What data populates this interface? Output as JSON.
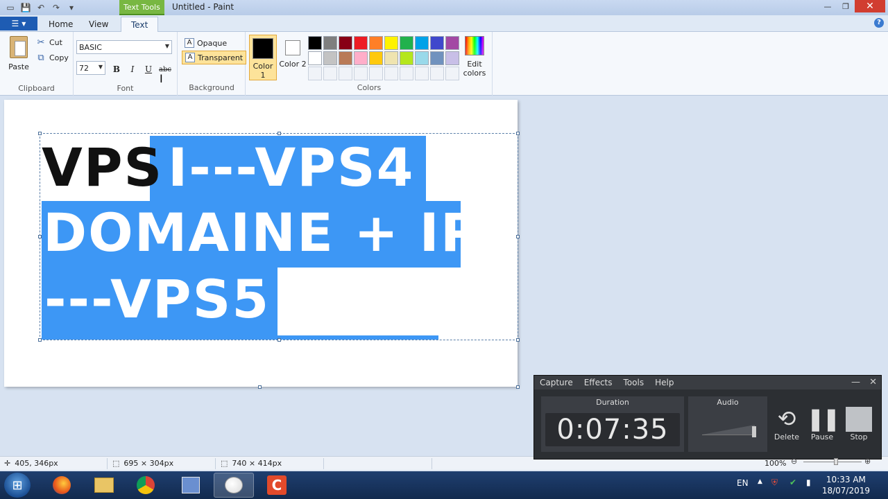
{
  "window": {
    "title": "Untitled - Paint",
    "context_tab": "Text Tools"
  },
  "tabs": [
    {
      "label": "Home"
    },
    {
      "label": "View"
    },
    {
      "label": "Text"
    }
  ],
  "clipboard": {
    "paste": "Paste",
    "cut": "Cut",
    "copy": "Copy",
    "group": "Clipboard"
  },
  "font": {
    "family": "BASIC",
    "size": "72",
    "bold": "B",
    "italic": "I",
    "underline": "U",
    "strike": "abc",
    "group": "Font"
  },
  "background": {
    "opaque": "Opaque",
    "transparent": "Transparent",
    "group": "Background"
  },
  "colors": {
    "color1_label": "Color 1",
    "color2_label": "Color 2",
    "group": "Colors",
    "edit": "Edit colors",
    "color1": "#000000",
    "color2": "#ffffff",
    "palette": [
      "#000000",
      "#7f7f7f",
      "#880015",
      "#ed1c24",
      "#ff7f27",
      "#fff200",
      "#22b14c",
      "#00a2e8",
      "#3f48cc",
      "#a349a4",
      "#ffffff",
      "#c3c3c3",
      "#b97a57",
      "#ffaec9",
      "#ffc90e",
      "#efe4b0",
      "#b5e61d",
      "#99d9ea",
      "#7092be",
      "#c8bfe7"
    ]
  },
  "canvas": {
    "line1_black": "VPS",
    "line1_white": "I---VPS4",
    "line2": "DOMAINE + IP",
    "line3": "---VPS5",
    "highlight_color": "#3d97f5"
  },
  "status": {
    "cursor": "405, 346px",
    "selection": "695 × 304px",
    "image": "740 × 414px",
    "zoom": "100%"
  },
  "recorder": {
    "menu": [
      "Capture",
      "Effects",
      "Tools",
      "Help"
    ],
    "duration_label": "Duration",
    "duration": "0:07:35",
    "audio_label": "Audio",
    "delete": "Delete",
    "pause": "Pause",
    "stop": "Stop"
  },
  "taskbar": {
    "lang": "EN",
    "time": "10:33 AM",
    "date": "18/07/2019"
  }
}
